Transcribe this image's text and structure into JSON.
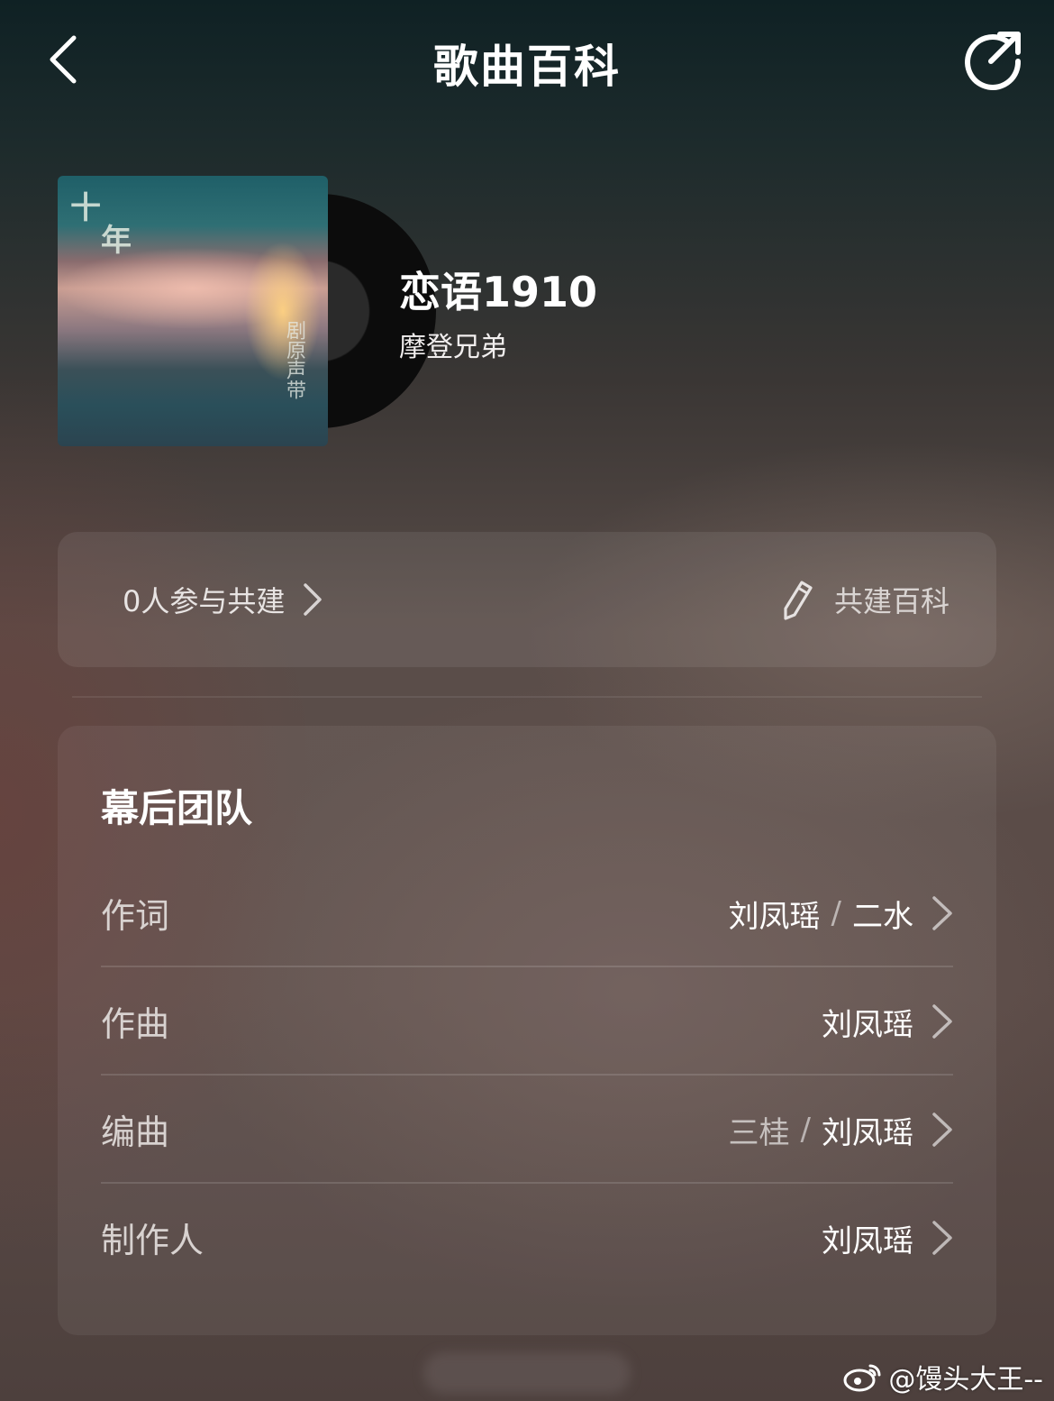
{
  "header": {
    "title": "歌曲百科",
    "back_icon": "chevron-left-icon",
    "share_icon": "share-icon"
  },
  "song": {
    "title": "恋语1910",
    "artist": "摩登兄弟"
  },
  "contribute": {
    "participants_label": "0人参与共建",
    "build_label": "共建百科"
  },
  "team": {
    "title": "幕后团队",
    "rows": [
      {
        "label": "作词",
        "names": [
          "刘凤瑶",
          "二水"
        ]
      },
      {
        "label": "作曲",
        "names": [
          "刘凤瑶"
        ]
      },
      {
        "label": "编曲",
        "names": [
          "三桂",
          "刘凤瑶"
        ]
      },
      {
        "label": "制作人",
        "names": [
          "刘凤瑶"
        ]
      }
    ]
  },
  "watermark": {
    "text": "@馒头大王--"
  },
  "colors": {
    "background_top": "#0f2124",
    "background_bottom": "#5c4c48",
    "card_overlay": "rgba(255,255,255,0.08)"
  }
}
